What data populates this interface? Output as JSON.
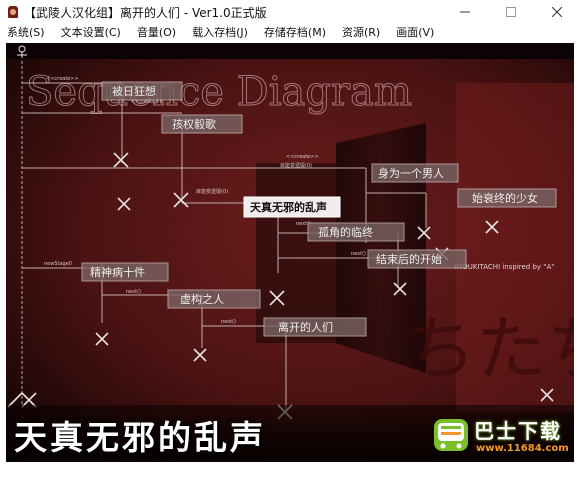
{
  "window": {
    "title": "【武陵人汉化组】离开的人们 - Ver1.0正式版",
    "minimize_glyph": "—",
    "maximize_glyph": "□",
    "close_glyph": "✕"
  },
  "menu": [
    {
      "label": "系统(S)"
    },
    {
      "label": "文本设置(C)"
    },
    {
      "label": "音量(O)"
    },
    {
      "label": "载入存档(J)"
    },
    {
      "label": "存储存档(M)"
    },
    {
      "label": "资源(R)"
    },
    {
      "label": "画面(V)"
    }
  ],
  "scene": {
    "title_art": "Sequence Diagram",
    "side_art": "KYOUKITACHI inspired by \"A\"",
    "big_kana": "ちたち",
    "subtitle": "天真无邪的乱声",
    "boxes": [
      {
        "label": "被日狂想"
      },
      {
        "label": "孩权毅歌"
      },
      {
        "label": "天真无邪的乱声"
      },
      {
        "label": "身为一个男人"
      },
      {
        "label": "始衰终的少女"
      },
      {
        "label": "孤角的临终"
      },
      {
        "label": "结束后的开始"
      },
      {
        "label": "精神病十件"
      },
      {
        "label": "虚构之人"
      },
      {
        "label": "离开的人们"
      }
    ],
    "small_labels": [
      "<<create>>",
      "目能变遗毁(0)",
      "next()",
      "newStage0",
      "next()"
    ],
    "palette": {
      "bg_red": "#5a1616",
      "line": "#d8c8c8",
      "text": "#eeeeee",
      "highlight_bg": "#f3ecec"
    }
  },
  "watermark": {
    "name": "巴士下载",
    "url": "www.11684.com",
    "accent_green": "#7bbf2a",
    "accent_orange": "#f39a2a"
  }
}
